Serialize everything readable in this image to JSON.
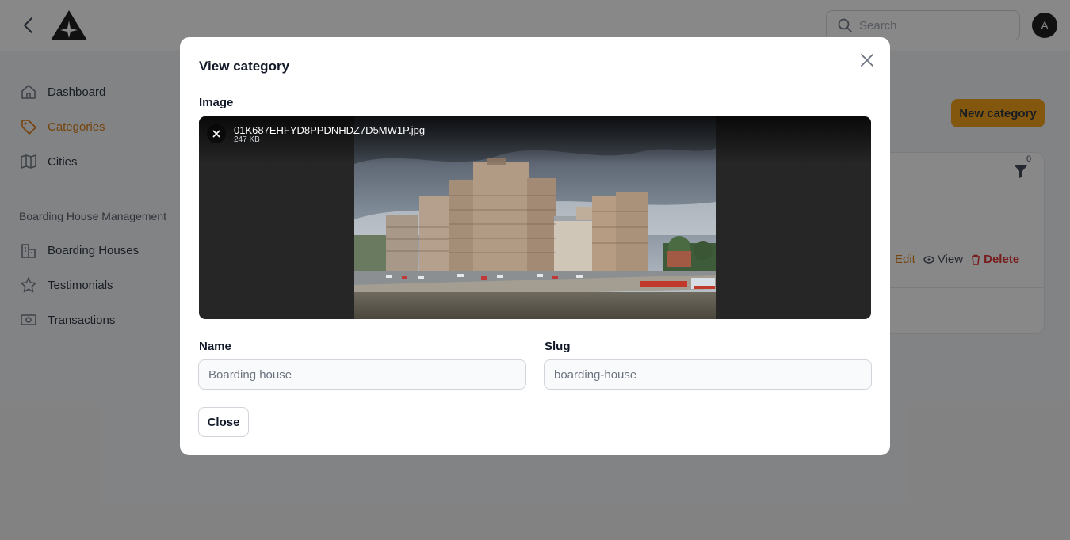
{
  "header": {
    "search_placeholder": "Search",
    "avatar_initial": "A"
  },
  "sidebar": {
    "items": [
      {
        "label": "Dashboard",
        "icon": "home-icon"
      },
      {
        "label": "Categories",
        "icon": "tag-icon",
        "active": true
      },
      {
        "label": "Cities",
        "icon": "map-icon"
      }
    ],
    "group_label": "Boarding House Management",
    "group_items": [
      {
        "label": "Boarding Houses",
        "icon": "building-icon"
      },
      {
        "label": "Testimonials",
        "icon": "star-icon"
      },
      {
        "label": "Transactions",
        "icon": "banknote-icon"
      }
    ]
  },
  "page": {
    "new_category_label": "New category",
    "filter_count": "0",
    "row_actions": {
      "edit": "Edit",
      "view": "View",
      "delete": "Delete"
    }
  },
  "modal": {
    "title": "View category",
    "image_label": "Image",
    "file_name": "01K687EHFYD8PPDNHDZ7D5MW1P.jpg",
    "file_size": "247 KB",
    "name_label": "Name",
    "name_value": "Boarding house",
    "slug_label": "Slug",
    "slug_value": "boarding-house",
    "close_label": "Close"
  },
  "colors": {
    "accent": "#d97706",
    "primary_button": "#f59e0b",
    "danger": "#dc2626"
  }
}
